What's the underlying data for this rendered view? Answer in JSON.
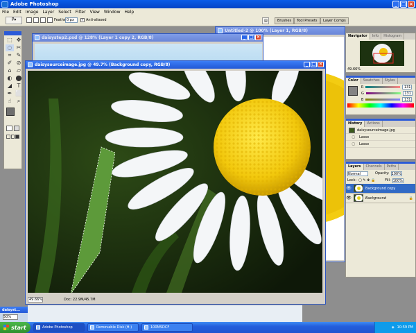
{
  "app": {
    "title": "Adobe Photoshop",
    "window_buttons": [
      "_",
      "□",
      "×"
    ]
  },
  "menu": [
    "File",
    "Edit",
    "Image",
    "Layer",
    "Select",
    "Filter",
    "View",
    "Window",
    "Help"
  ],
  "options": {
    "feather_label": "Feather:",
    "feather_value": "0 px",
    "antialias_label": "Anti-aliased",
    "antialias_checked": "✓",
    "well_tabs": [
      "Brushes",
      "Tool Presets",
      "Layer Comps"
    ]
  },
  "tools": {
    "icons": [
      "⬚",
      "✥",
      "◌",
      "✂",
      "⌗",
      "✎",
      "✐",
      "⊘",
      "⌂",
      "▱",
      "◐",
      "⬤",
      "◢",
      "T",
      "✒",
      "⬜",
      "☝",
      "⌕"
    ],
    "fg_color": "#6e6e6e",
    "bg_color": "#ffffff"
  },
  "documents": {
    "back_title": "Untitled-2 @ 100% (Layer 1, RGB/8)",
    "mid_title": "daisystep2.psd @ 128% (Layer 1 copy 2, RGB/8)",
    "main_title": "daisysourceimage.jpg @ 49.7% (Background copy, RGB/8)",
    "main_zoom": "49.66%",
    "main_doc_info": "Doc: 22.9M/45.7M",
    "min_title": "daisyst...",
    "min_zoom": "50%"
  },
  "navigator": {
    "tabs": [
      "Navigator",
      "Info",
      "Histogram"
    ],
    "zoom": "49.66%"
  },
  "color": {
    "tabs": [
      "Color",
      "Swatches",
      "Styles"
    ],
    "channels": [
      {
        "label": "R",
        "value": "131"
      },
      {
        "label": "G",
        "value": "131"
      },
      {
        "label": "B",
        "value": "131"
      }
    ]
  },
  "history": {
    "tabs": [
      "History",
      "Actions"
    ],
    "snapshot": "daisysourceimage.jpg",
    "steps": [
      "Lasso",
      "Lasso"
    ]
  },
  "layers": {
    "tabs": [
      "Layers",
      "Channels",
      "Paths"
    ],
    "blend_mode": "Normal",
    "opacity_label": "Opacity:",
    "opacity": "100%",
    "lock_label": "Lock:",
    "fill_label": "Fill:",
    "fill": "100%",
    "items": [
      {
        "name": "Background copy",
        "selected": true
      },
      {
        "name": "Background",
        "selected": false
      }
    ]
  },
  "taskbar": {
    "start": "start",
    "tasks": [
      "Adobe Photoshop",
      "Removable Disk (H:)",
      "100MSDCF"
    ],
    "time": "10:59 PM"
  }
}
